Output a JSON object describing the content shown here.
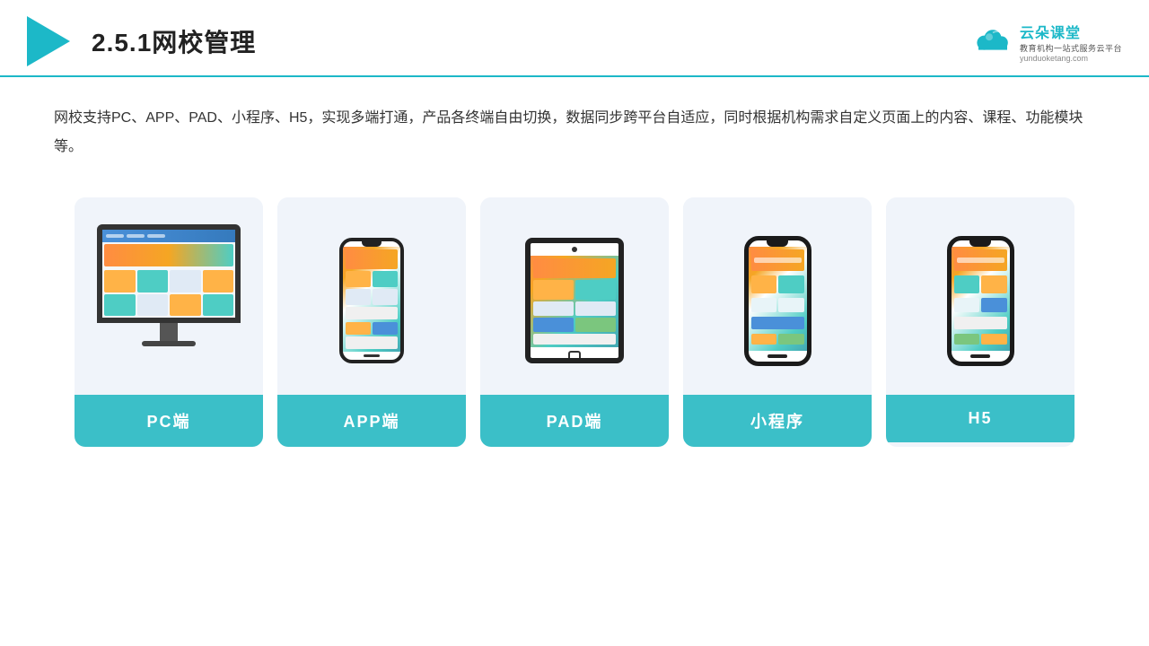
{
  "header": {
    "title": "2.5.1网校管理",
    "brand": {
      "name": "云朵课堂",
      "tagline": "教育机构一站式服务云平台",
      "url": "yunduoketang.com"
    }
  },
  "description": "网校支持PC、APP、PAD、小程序、H5，实现多端打通，产品各终端自由切换，数据同步跨平台自适应，同时根据机构需求自定义页面上的内容、课程、功能模块等。",
  "cards": [
    {
      "id": "pc",
      "label": "PC端"
    },
    {
      "id": "app",
      "label": "APP端"
    },
    {
      "id": "pad",
      "label": "PAD端"
    },
    {
      "id": "miniprogram",
      "label": "小程序"
    },
    {
      "id": "h5",
      "label": "H5"
    }
  ],
  "colors": {
    "accent": "#1cb8c8",
    "card_label_bg": "#3bbfc8",
    "card_bg": "#f0f4fa"
  }
}
